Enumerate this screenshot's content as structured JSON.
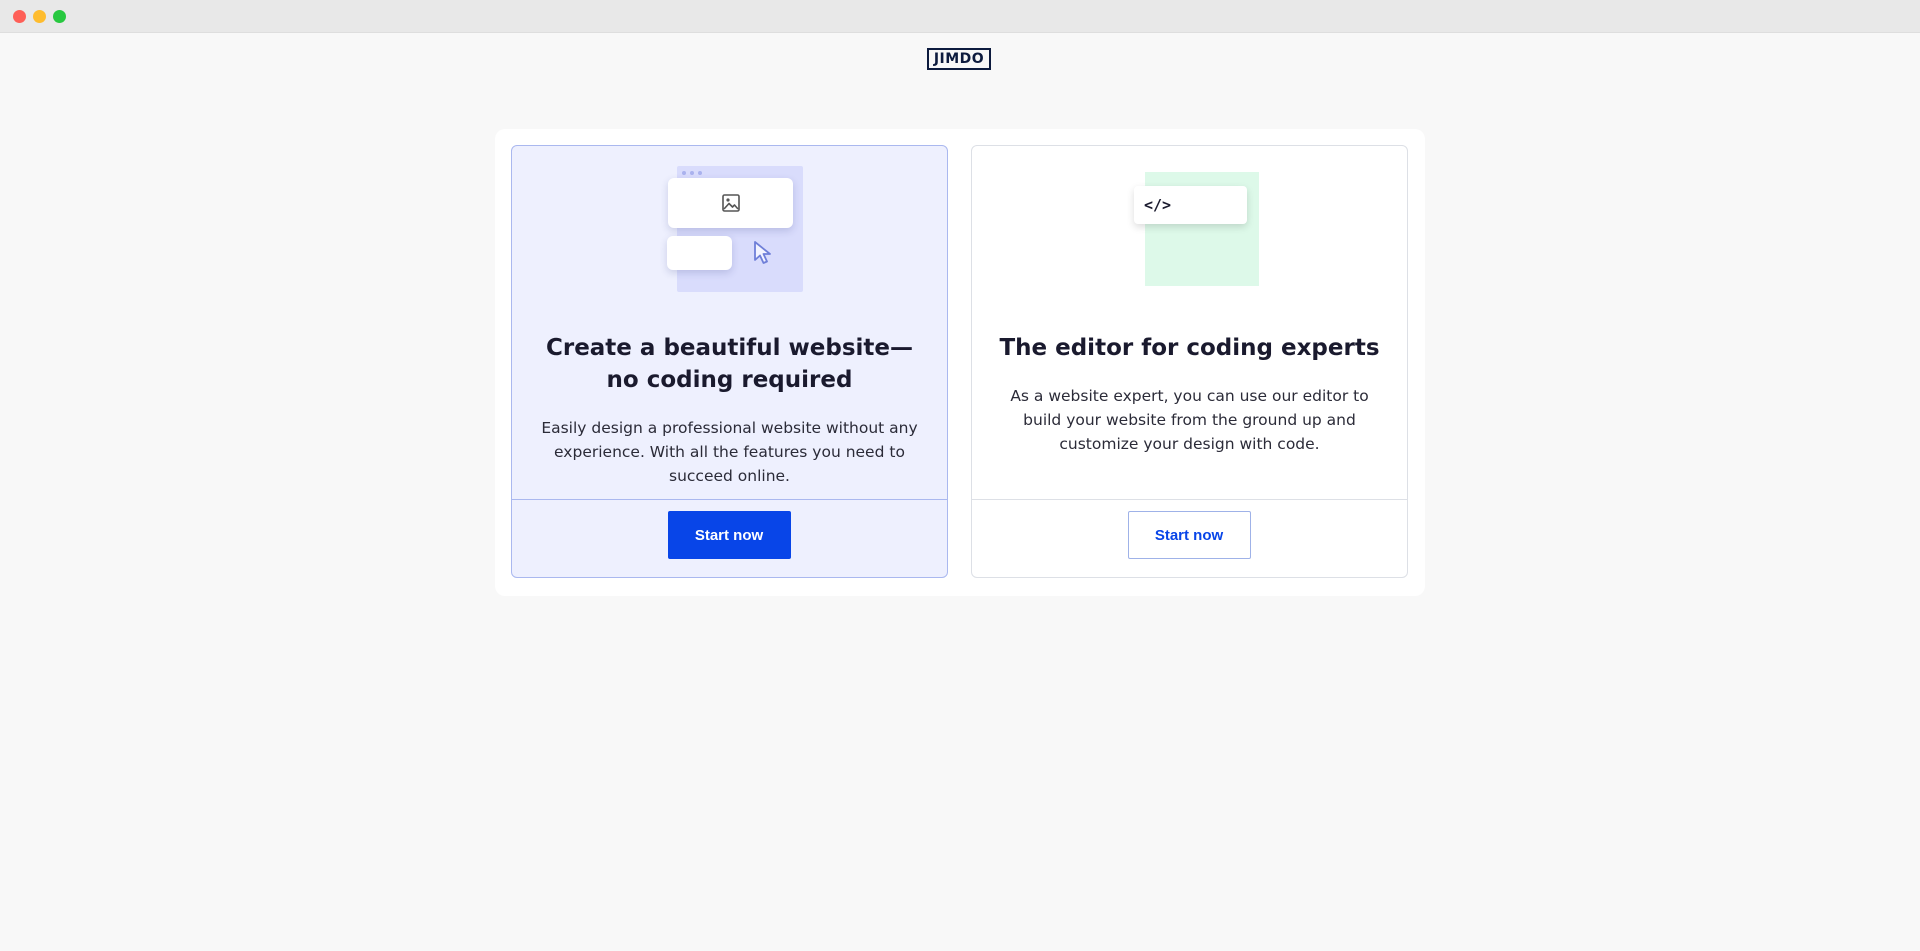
{
  "brand": {
    "logo_text": "JIMDO"
  },
  "options": [
    {
      "title": "Create a beautiful website—no coding required",
      "description": "Easily design a professional website without any experience. With all the features you need to succeed online.",
      "button_label": "Start now",
      "icons": [
        "image-icon",
        "cursor-icon"
      ]
    },
    {
      "title": "The editor for coding experts",
      "description": "As a website expert, you can use our editor to build your website from the ground up and customize your design with code.",
      "button_label": "Start now",
      "code_glyph": "</>"
    }
  ],
  "colors": {
    "primary": "#0845e8",
    "selected_card_bg": "#eef0fe",
    "selected_card_border": "#aab8ef",
    "code_card_bg": "#ddf9e9"
  }
}
